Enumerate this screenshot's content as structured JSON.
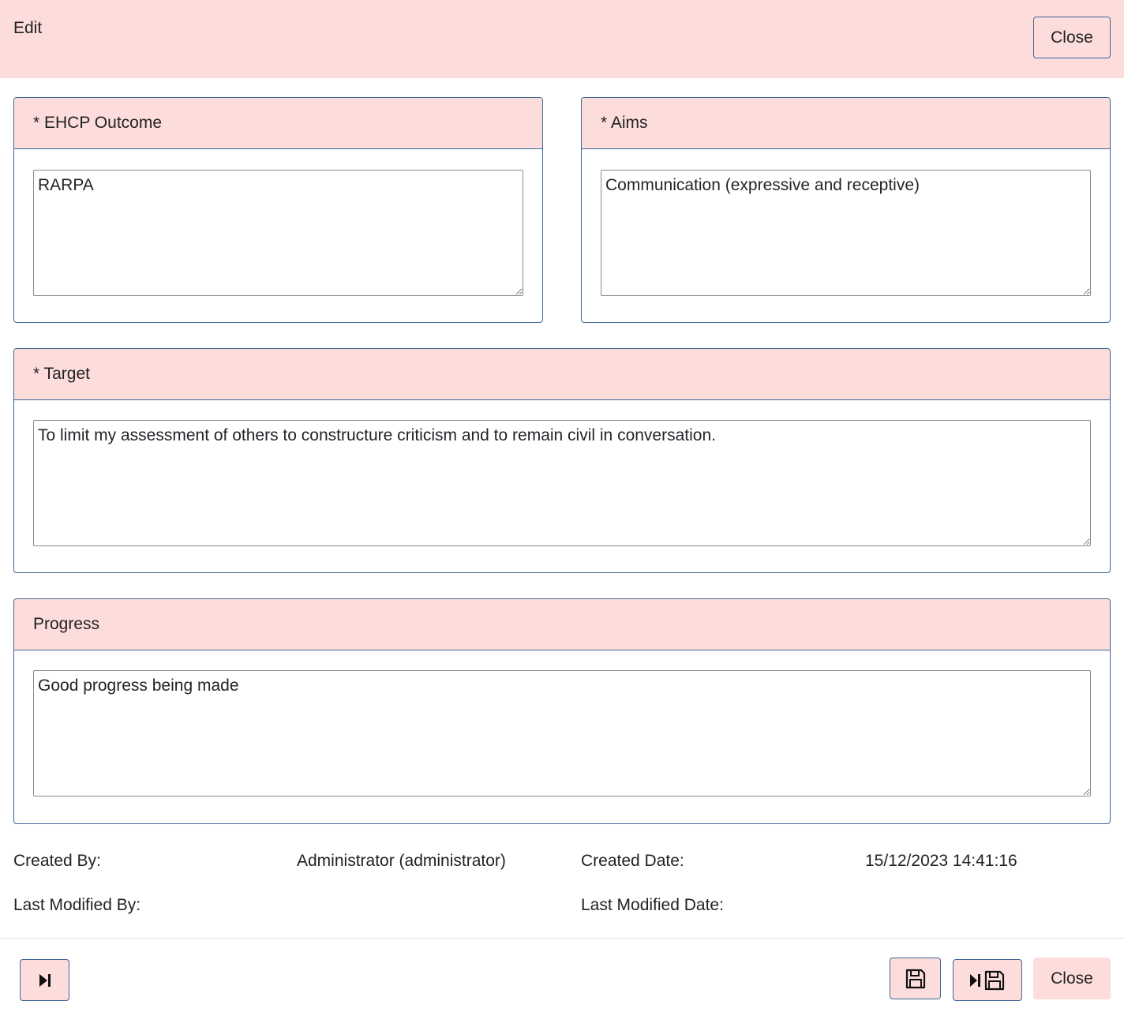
{
  "header": {
    "title": "Edit",
    "close_label": "Close"
  },
  "panels": {
    "ehcp_outcome": {
      "label": "* EHCP Outcome",
      "value": "RARPA"
    },
    "aims": {
      "label": "* Aims",
      "value": "Communication (expressive and receptive)"
    },
    "target": {
      "label": "* Target",
      "value": "To limit my assessment of others to constructure criticism and to remain civil in conversation."
    },
    "progress": {
      "label": "Progress",
      "value": "Good progress being made"
    }
  },
  "meta": {
    "created_by_label": "Created By:",
    "created_by_value": "Administrator (administrator)",
    "created_date_label": "Created Date:",
    "created_date_value": "15/12/2023 14:41:16",
    "last_modified_by_label": "Last Modified By:",
    "last_modified_by_value": "",
    "last_modified_date_label": "Last Modified Date:",
    "last_modified_date_value": ""
  },
  "footer": {
    "next_icon": "skip-next-icon",
    "save_icon": "floppy-disk-icon",
    "next_save_icon": "skip-next-save-icon",
    "close_label": "Close"
  },
  "colors": {
    "header_bg": "#fddcdc",
    "panel_border": "#3f6796"
  }
}
